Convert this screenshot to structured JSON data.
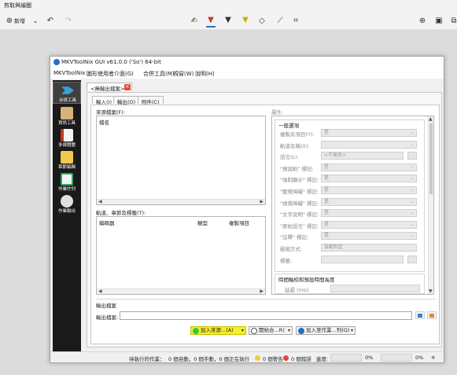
{
  "snip": {
    "title": "剪取與繪圖",
    "new_label": "新增"
  },
  "window": {
    "title": "MKVToolNix GUI v61.0.0 ('So') 64-bit",
    "menu": [
      "MKVToolNix",
      "圖形使用者介面(G)",
      "合併工具(M)",
      "視窗(W)",
      "說明(H)"
    ]
  },
  "sidebar": [
    {
      "label": "合併工具",
      "color": "#3aa0d8"
    },
    {
      "label": "資訊工具",
      "color": "#d9b27a"
    },
    {
      "label": "多媒體體",
      "color": "#c0392b"
    },
    {
      "label": "章節編輯",
      "color": "#f2c94c"
    },
    {
      "label": "作業佇列",
      "color": "#27ae60"
    },
    {
      "label": "作業輸出",
      "color": "#e0e0e0"
    }
  ],
  "job_tab": "<無輸出檔案>",
  "inner_tabs": [
    "輸入(I)",
    "輸出(O)",
    "附件(C)"
  ],
  "source_files": {
    "label": "來源檔案(F):",
    "column": "檔名"
  },
  "tracks": {
    "label": "軌道、章節及標籤(T):",
    "columns": [
      "編碼器",
      "類型",
      "複製項目"
    ]
  },
  "properties": {
    "label": "屬性:",
    "general_group": "一般選項",
    "rows": [
      {
        "label": "複製此項目(Y):",
        "value": "是"
      },
      {
        "label": "軌道名稱(X):",
        "value": ""
      },
      {
        "label": "語言(L):",
        "value": "<不更改>"
      },
      {
        "label": "\"預設軌\" 標記:",
        "value": "是"
      },
      {
        "label": "\"強制顯示\" 標記:",
        "value": "是"
      },
      {
        "label": "\"聽覺障礙\" 標記:",
        "value": "是"
      },
      {
        "label": "\"視覺障礙\" 標記:",
        "value": "是"
      },
      {
        "label": "\"文字說明\" 標記:",
        "value": "是"
      },
      {
        "label": "\"原始語言\" 標記:",
        "value": "是"
      },
      {
        "label": "\"註釋\" 標記:",
        "value": "是"
      },
      {
        "label": "壓縮方式:",
        "value": "自動判定"
      },
      {
        "label": "標籤:",
        "value": ""
      }
    ],
    "timing_group": "時間軸校和預設時間長度",
    "delay_label": "延遲 (ms):"
  },
  "output": {
    "group": "輸出檔案",
    "file_label": "輸出檔案:",
    "value": ""
  },
  "buttons": {
    "add_source": "加入來源...(A)",
    "start": "開始合...R)",
    "add_queue": "加入至作業...列(Q)"
  },
  "status": {
    "pending": "待執行的作業：",
    "auto": "0 個自動，0 個手動，0 個正在執行",
    "warnings": "0 個警告",
    "errors": "0 個錯誤",
    "progress_label": "進度:",
    "progress1": "0%",
    "progress2": "0%"
  }
}
